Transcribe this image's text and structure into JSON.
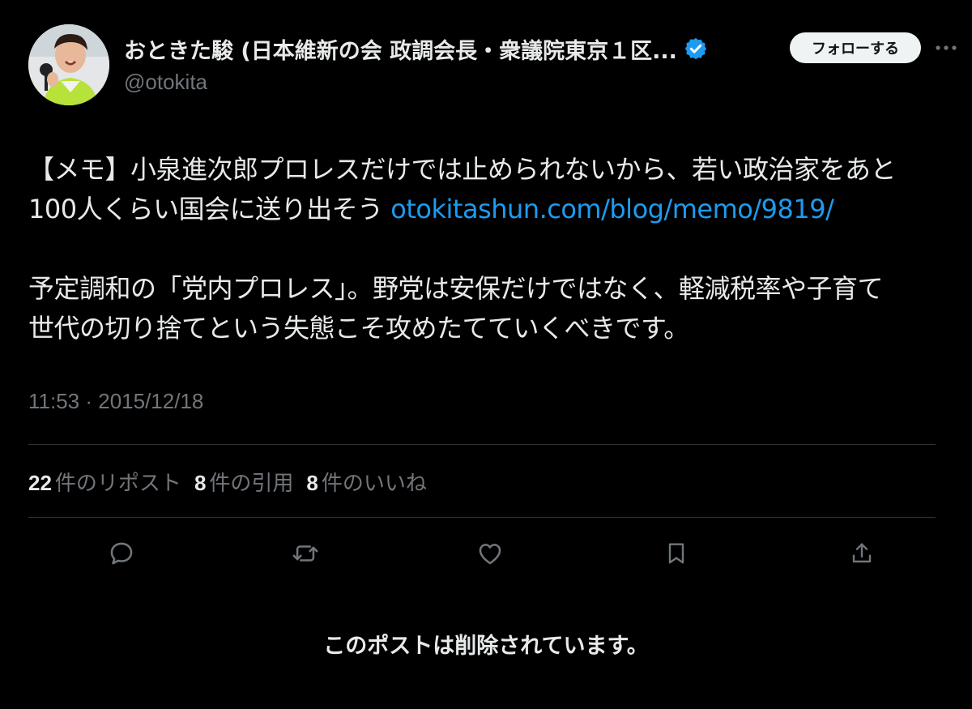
{
  "author": {
    "display_name": "おときた駿 (日本維新の会 政調会長・衆議院東京１区...",
    "handle": "@otokita",
    "verified_icon": "verified-badge-icon",
    "avatar_icon": "profile-photo"
  },
  "header": {
    "follow_label": "フォローする",
    "more_icon": "more-dots-icon"
  },
  "tweet": {
    "line1": "【メモ】小泉進次郎プロレスだけでは止められないから、若い政治家をあと",
    "line2_text": "100人くらい国会に送り出そう ",
    "link_text": "otokitashun.com/blog/memo/9819/",
    "line3": "予定調和の「党内プロレス」。野党は安保だけではなく、軽減税率や子育て",
    "line4": "世代の切り捨てという失態こそ攻めたてていくべきです。"
  },
  "timestamp": "11:53 · 2015/12/18",
  "stats": {
    "reposts_count": "22",
    "reposts_label": "件のリポスト",
    "quotes_count": "8",
    "quotes_label": "件の引用",
    "likes_count": "8",
    "likes_label": "件のいいね"
  },
  "actions": [
    {
      "icon": "reply-icon"
    },
    {
      "icon": "repost-icon"
    },
    {
      "icon": "like-icon"
    },
    {
      "icon": "bookmark-icon"
    },
    {
      "icon": "share-icon"
    }
  ],
  "deleted_notice": "このポストは削除されています。",
  "colors": {
    "background": "#000000",
    "text": "#e7e9ea",
    "secondary": "#71767b",
    "link": "#1d9bf0",
    "divider": "#2f3336",
    "follow_bg": "#eff3f4"
  }
}
